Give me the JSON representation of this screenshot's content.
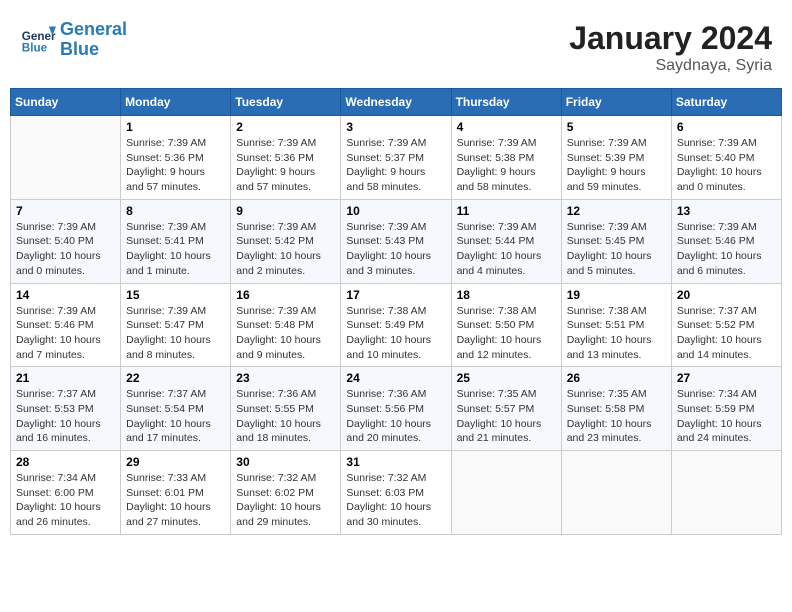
{
  "header": {
    "logo_line1": "General",
    "logo_line2": "Blue",
    "month_title": "January 2024",
    "location": "Saydnaya, Syria"
  },
  "weekdays": [
    "Sunday",
    "Monday",
    "Tuesday",
    "Wednesday",
    "Thursday",
    "Friday",
    "Saturday"
  ],
  "weeks": [
    [
      {
        "day": "",
        "info": ""
      },
      {
        "day": "1",
        "info": "Sunrise: 7:39 AM\nSunset: 5:36 PM\nDaylight: 9 hours\nand 57 minutes."
      },
      {
        "day": "2",
        "info": "Sunrise: 7:39 AM\nSunset: 5:36 PM\nDaylight: 9 hours\nand 57 minutes."
      },
      {
        "day": "3",
        "info": "Sunrise: 7:39 AM\nSunset: 5:37 PM\nDaylight: 9 hours\nand 58 minutes."
      },
      {
        "day": "4",
        "info": "Sunrise: 7:39 AM\nSunset: 5:38 PM\nDaylight: 9 hours\nand 58 minutes."
      },
      {
        "day": "5",
        "info": "Sunrise: 7:39 AM\nSunset: 5:39 PM\nDaylight: 9 hours\nand 59 minutes."
      },
      {
        "day": "6",
        "info": "Sunrise: 7:39 AM\nSunset: 5:40 PM\nDaylight: 10 hours\nand 0 minutes."
      }
    ],
    [
      {
        "day": "7",
        "info": "Sunrise: 7:39 AM\nSunset: 5:40 PM\nDaylight: 10 hours\nand 0 minutes."
      },
      {
        "day": "8",
        "info": "Sunrise: 7:39 AM\nSunset: 5:41 PM\nDaylight: 10 hours\nand 1 minute."
      },
      {
        "day": "9",
        "info": "Sunrise: 7:39 AM\nSunset: 5:42 PM\nDaylight: 10 hours\nand 2 minutes."
      },
      {
        "day": "10",
        "info": "Sunrise: 7:39 AM\nSunset: 5:43 PM\nDaylight: 10 hours\nand 3 minutes."
      },
      {
        "day": "11",
        "info": "Sunrise: 7:39 AM\nSunset: 5:44 PM\nDaylight: 10 hours\nand 4 minutes."
      },
      {
        "day": "12",
        "info": "Sunrise: 7:39 AM\nSunset: 5:45 PM\nDaylight: 10 hours\nand 5 minutes."
      },
      {
        "day": "13",
        "info": "Sunrise: 7:39 AM\nSunset: 5:46 PM\nDaylight: 10 hours\nand 6 minutes."
      }
    ],
    [
      {
        "day": "14",
        "info": "Sunrise: 7:39 AM\nSunset: 5:46 PM\nDaylight: 10 hours\nand 7 minutes."
      },
      {
        "day": "15",
        "info": "Sunrise: 7:39 AM\nSunset: 5:47 PM\nDaylight: 10 hours\nand 8 minutes."
      },
      {
        "day": "16",
        "info": "Sunrise: 7:39 AM\nSunset: 5:48 PM\nDaylight: 10 hours\nand 9 minutes."
      },
      {
        "day": "17",
        "info": "Sunrise: 7:38 AM\nSunset: 5:49 PM\nDaylight: 10 hours\nand 10 minutes."
      },
      {
        "day": "18",
        "info": "Sunrise: 7:38 AM\nSunset: 5:50 PM\nDaylight: 10 hours\nand 12 minutes."
      },
      {
        "day": "19",
        "info": "Sunrise: 7:38 AM\nSunset: 5:51 PM\nDaylight: 10 hours\nand 13 minutes."
      },
      {
        "day": "20",
        "info": "Sunrise: 7:37 AM\nSunset: 5:52 PM\nDaylight: 10 hours\nand 14 minutes."
      }
    ],
    [
      {
        "day": "21",
        "info": "Sunrise: 7:37 AM\nSunset: 5:53 PM\nDaylight: 10 hours\nand 16 minutes."
      },
      {
        "day": "22",
        "info": "Sunrise: 7:37 AM\nSunset: 5:54 PM\nDaylight: 10 hours\nand 17 minutes."
      },
      {
        "day": "23",
        "info": "Sunrise: 7:36 AM\nSunset: 5:55 PM\nDaylight: 10 hours\nand 18 minutes."
      },
      {
        "day": "24",
        "info": "Sunrise: 7:36 AM\nSunset: 5:56 PM\nDaylight: 10 hours\nand 20 minutes."
      },
      {
        "day": "25",
        "info": "Sunrise: 7:35 AM\nSunset: 5:57 PM\nDaylight: 10 hours\nand 21 minutes."
      },
      {
        "day": "26",
        "info": "Sunrise: 7:35 AM\nSunset: 5:58 PM\nDaylight: 10 hours\nand 23 minutes."
      },
      {
        "day": "27",
        "info": "Sunrise: 7:34 AM\nSunset: 5:59 PM\nDaylight: 10 hours\nand 24 minutes."
      }
    ],
    [
      {
        "day": "28",
        "info": "Sunrise: 7:34 AM\nSunset: 6:00 PM\nDaylight: 10 hours\nand 26 minutes."
      },
      {
        "day": "29",
        "info": "Sunrise: 7:33 AM\nSunset: 6:01 PM\nDaylight: 10 hours\nand 27 minutes."
      },
      {
        "day": "30",
        "info": "Sunrise: 7:32 AM\nSunset: 6:02 PM\nDaylight: 10 hours\nand 29 minutes."
      },
      {
        "day": "31",
        "info": "Sunrise: 7:32 AM\nSunset: 6:03 PM\nDaylight: 10 hours\nand 30 minutes."
      },
      {
        "day": "",
        "info": ""
      },
      {
        "day": "",
        "info": ""
      },
      {
        "day": "",
        "info": ""
      }
    ]
  ]
}
